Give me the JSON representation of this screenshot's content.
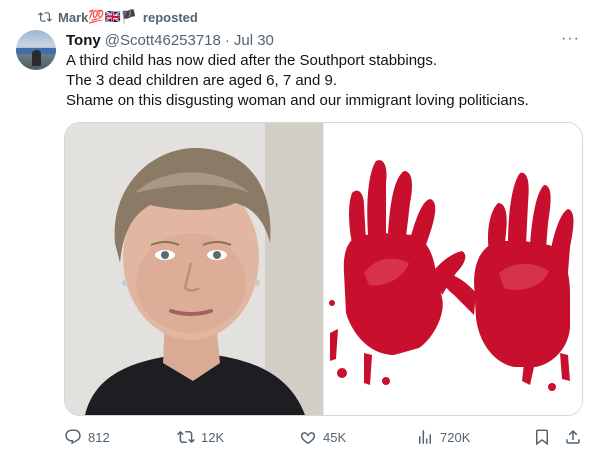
{
  "repost": {
    "user": "Mark",
    "flags": "💯🇬🇧🏴",
    "label": "reposted"
  },
  "tweet": {
    "author_name": "Tony",
    "handle": "@Scott46253718",
    "separator": "·",
    "date": "Jul 30",
    "more": "···",
    "lines": [
      "A third child has now died after the Southport stabbings.",
      "The 3 dead children are aged 6, 7 and 9.",
      "Shame on this disgusting woman and our immigrant loving politicians."
    ]
  },
  "actions": {
    "replies": "812",
    "reposts": "12K",
    "likes": "45K",
    "views": "720K"
  },
  "icons": {
    "repost": "repost-icon",
    "reply": "reply-icon",
    "retweet": "retweet-icon",
    "like": "heart-icon",
    "views": "analytics-icon",
    "bookmark": "bookmark-icon",
    "share": "share-icon",
    "more": "more-icon"
  },
  "colors": {
    "secondary_text": "#536471",
    "text": "#0f1419",
    "border": "#cfd9de",
    "blood": "#c8102e"
  }
}
